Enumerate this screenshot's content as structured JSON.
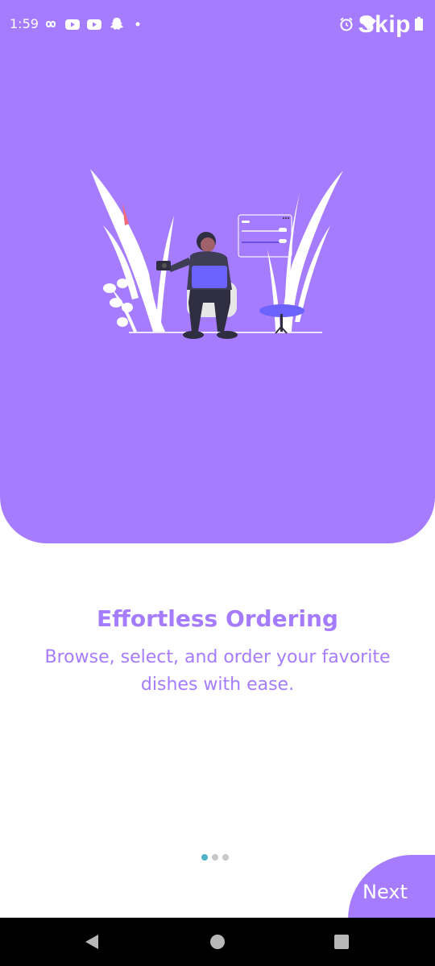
{
  "status_bar": {
    "time": "1:59",
    "left_icons": [
      "infinity-icon",
      "youtube-icon",
      "youtube-icon",
      "snapchat-icon",
      "dot-icon"
    ],
    "right_icons": [
      "alarm-icon",
      "wifi-icon",
      "battery-icon"
    ]
  },
  "header": {
    "skip_label": "Skip"
  },
  "slide": {
    "title": "Effortless Ordering",
    "subtitle": "Browse, select, and order your favorite dishes with ease.",
    "page_index": 1,
    "page_count": 3
  },
  "footer": {
    "next_label": "Next"
  },
  "nav_bar": {
    "buttons": [
      "back-icon",
      "home-icon",
      "recents-icon"
    ]
  },
  "colors": {
    "accent": "#a57cfd",
    "dot_active": "#4fb3c8",
    "dot_inactive": "#c8c8c8",
    "background": "#ffffff",
    "nav_bar": "#000000"
  }
}
